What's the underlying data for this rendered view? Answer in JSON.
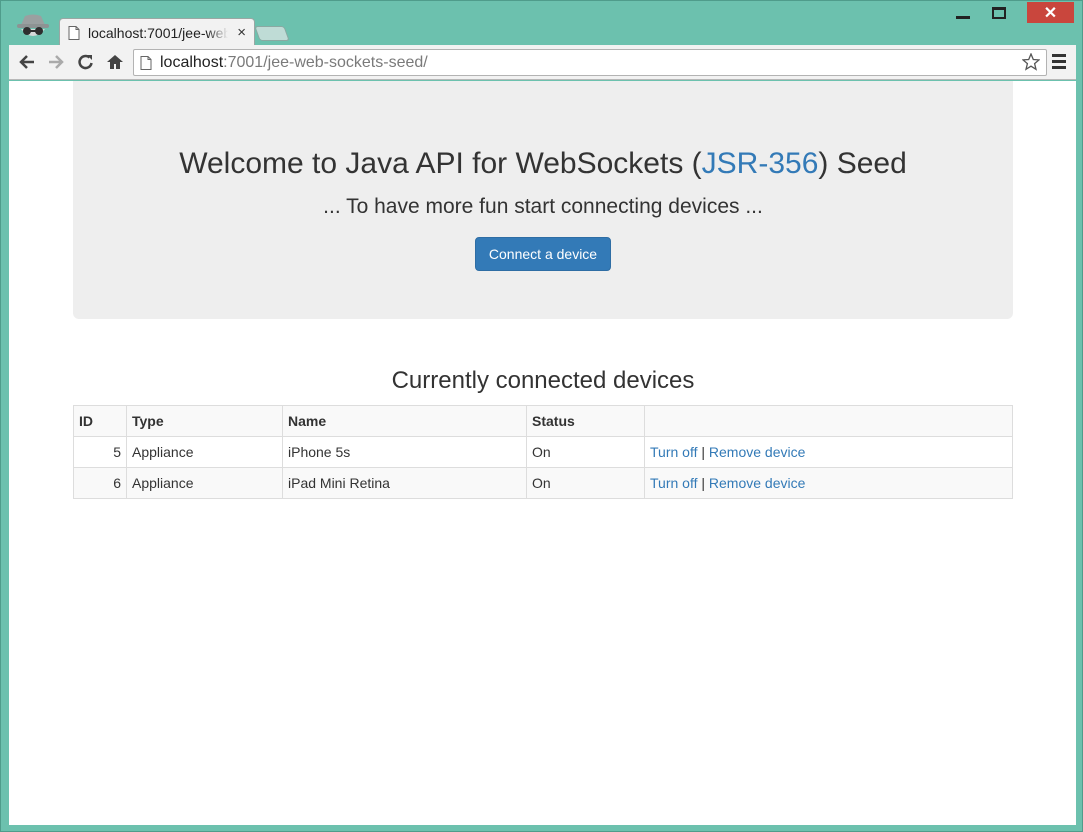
{
  "browser": {
    "tab_title": "localhost:7001/jee-web-sockets-seed/",
    "tab_close": "×",
    "url_host": "localhost",
    "url_path": ":7001/jee-web-sockets-seed/",
    "close_glyph": "✕"
  },
  "jumbotron": {
    "title_prefix": "Welcome to Java API for WebSockets (",
    "title_link": "JSR-356",
    "title_suffix": ") Seed",
    "subtitle": "... To have more fun start connecting devices ...",
    "button_label": "Connect a device"
  },
  "devices": {
    "heading": "Currently connected devices",
    "columns": [
      "ID",
      "Type",
      "Name",
      "Status",
      ""
    ],
    "rows": [
      {
        "id": "5",
        "type": "Appliance",
        "name": "iPhone 5s",
        "status": "On",
        "turn_off": "Turn off",
        "separator": "|",
        "remove": "Remove device"
      },
      {
        "id": "6",
        "type": "Appliance",
        "name": "iPad Mini Retina",
        "status": "On",
        "turn_off": "Turn off",
        "separator": "|",
        "remove": "Remove device"
      }
    ]
  },
  "colors": {
    "frame": "#6cc1ae",
    "link": "#337ab7",
    "jumbotron_bg": "#eeeeee",
    "close_button": "#c9463d"
  }
}
